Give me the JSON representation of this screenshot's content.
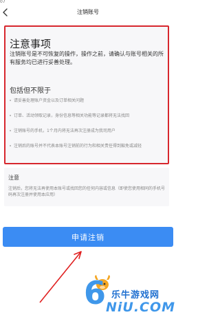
{
  "status_bar": {
    "time": "07"
  },
  "nav": {
    "title": "注销账号",
    "back_icon": "chevron-left-icon"
  },
  "notice": {
    "title": "注意事项",
    "description": "注销账号是不可恢复的操作，操作之前，请确认与账号相关的所有服务均已进行妥善处理。",
    "includes_title": "包括但不限于",
    "items": [
      "请妥善处理账户资金以及订单相关问题",
      "订单、活动领取记录，身份信息等相关功能等记录都将无法找回",
      "注销账号的手机，1个月内将无法再次注册成为我司用户",
      "注销后的账号并不代表本账号注销前的行为和相关责任得到豁免或减轻"
    ],
    "highlight_color": "#d7262d"
  },
  "note": {
    "title": "注意",
    "body": "注销后，您将无法再使用本账号或找回您的任何内容或信息（即使您使用相同的手机号码再次注册并使用本应用）"
  },
  "apply_button": {
    "label": "申请注销",
    "color": "#3b8cf3"
  },
  "watermark": {
    "digit": "6",
    "cn_text": "乐牛游戏网",
    "en_text": "NiU.COM"
  }
}
